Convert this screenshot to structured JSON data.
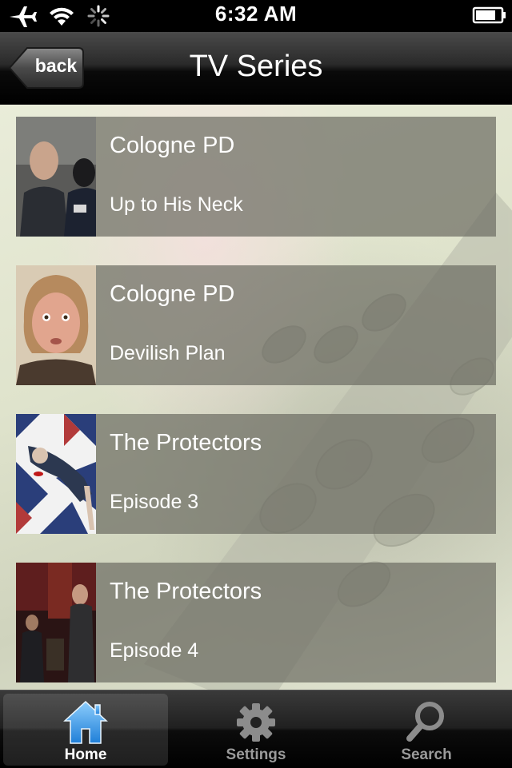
{
  "status_bar": {
    "time": "6:32 AM"
  },
  "nav": {
    "title": "TV Series",
    "back_label": "back"
  },
  "items": [
    {
      "series": "Cologne PD",
      "episode": "Up to His Neck"
    },
    {
      "series": "Cologne PD",
      "episode": "Devilish Plan"
    },
    {
      "series": "The Protectors",
      "episode": "Episode 3"
    },
    {
      "series": "The Protectors",
      "episode": "Episode 4"
    }
  ],
  "tabs": [
    {
      "label": "Home",
      "icon": "home-icon",
      "active": true
    },
    {
      "label": "Settings",
      "icon": "gear-icon",
      "active": false
    },
    {
      "label": "Search",
      "icon": "search-icon",
      "active": false
    }
  ],
  "colors": {
    "active_tab": "#4aa8f0",
    "inactive_tab": "#9a9a9a"
  }
}
